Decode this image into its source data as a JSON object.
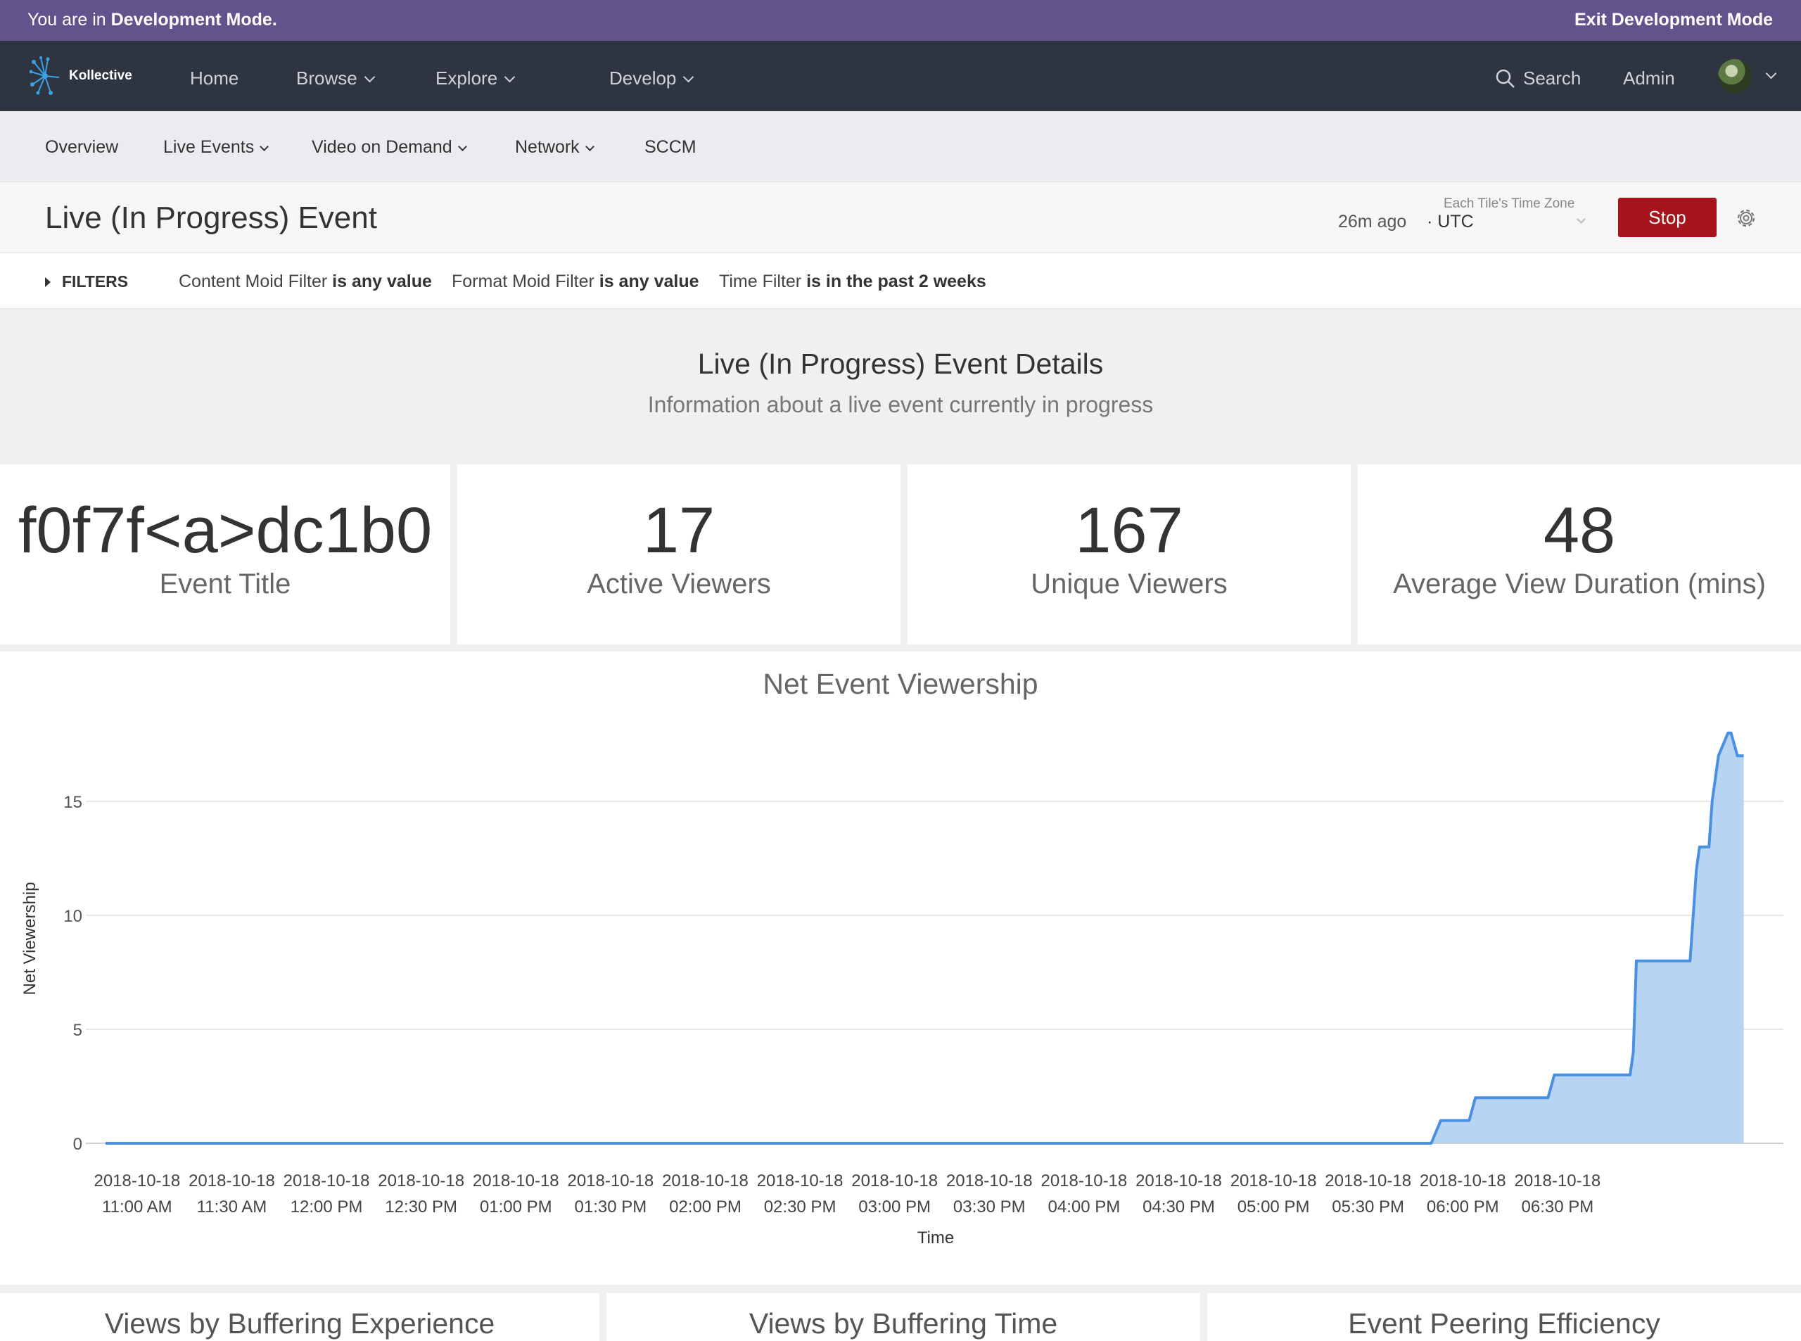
{
  "dev_banner": {
    "prefix": "You are in ",
    "mode": "Development Mode.",
    "exit": "Exit Development Mode"
  },
  "topnav": {
    "brand": "Kollective",
    "items": [
      "Home",
      "Browse",
      "Explore",
      "Develop"
    ],
    "search": "Search",
    "admin": "Admin"
  },
  "subnav": {
    "items": [
      "Overview",
      "Live Events",
      "Video on Demand",
      "Network",
      "SCCM"
    ]
  },
  "dashboard": {
    "title": "Live (In Progress) Event",
    "updated": "26m ago",
    "tz_label": "Each Tile's Time Zone",
    "tz_value": "UTC",
    "stop": "Stop"
  },
  "filters": {
    "toggle": "FILTERS",
    "items": [
      {
        "name": "Content Moid Filter",
        "value": "is any value"
      },
      {
        "name": "Format Moid Filter",
        "value": "is any value"
      },
      {
        "name": "Time Filter",
        "value": "is in the past 2 weeks"
      }
    ]
  },
  "details": {
    "title": "Live (In Progress) Event Details",
    "subtitle": "Information about a live event currently in progress"
  },
  "tiles": [
    {
      "value": "f0f7f<a>dc1b0",
      "label": "Event Title"
    },
    {
      "value": "17",
      "label": "Active Viewers"
    },
    {
      "value": "167",
      "label": "Unique Viewers"
    },
    {
      "value": "48",
      "label": "Average View Duration (mins)"
    }
  ],
  "chart_data": {
    "type": "area",
    "title": "Net Event Viewership",
    "xlabel": "Time",
    "ylabel": "Net Viewership",
    "ylim": [
      0,
      18
    ],
    "yticks": [
      0,
      5,
      10,
      15
    ],
    "xticks": [
      [
        "2018-10-18",
        "11:00 AM"
      ],
      [
        "2018-10-18",
        "11:30 AM"
      ],
      [
        "2018-10-18",
        "12:00 PM"
      ],
      [
        "2018-10-18",
        "12:30 PM"
      ],
      [
        "2018-10-18",
        "01:00 PM"
      ],
      [
        "2018-10-18",
        "01:30 PM"
      ],
      [
        "2018-10-18",
        "02:00 PM"
      ],
      [
        "2018-10-18",
        "02:30 PM"
      ],
      [
        "2018-10-18",
        "03:00 PM"
      ],
      [
        "2018-10-18",
        "03:30 PM"
      ],
      [
        "2018-10-18",
        "04:00 PM"
      ],
      [
        "2018-10-18",
        "04:30 PM"
      ],
      [
        "2018-10-18",
        "05:00 PM"
      ],
      [
        "2018-10-18",
        "05:30 PM"
      ],
      [
        "2018-10-18",
        "06:00 PM"
      ],
      [
        "2018-10-18",
        "06:30 PM"
      ]
    ],
    "color": "#4a90e2",
    "fill": "#b8d4f3",
    "series": [
      {
        "x": [
          "10:50",
          "17:50",
          "17:53",
          "18:02",
          "18:04",
          "18:27",
          "18:29",
          "18:53",
          "18:54",
          "18:55",
          "19:12",
          "19:14",
          "19:15",
          "19:18",
          "19:19",
          "19:21",
          "19:24",
          "19:25",
          "19:27",
          "19:29"
        ],
        "values": [
          0,
          0,
          1,
          1,
          2,
          2,
          3,
          3,
          4,
          8,
          8,
          12,
          13,
          13,
          15,
          17,
          18,
          18,
          17,
          17
        ]
      }
    ]
  },
  "bottom_tiles": [
    "Views by Buffering Experience",
    "Views by Buffering Time",
    "Event Peering Efficiency"
  ]
}
